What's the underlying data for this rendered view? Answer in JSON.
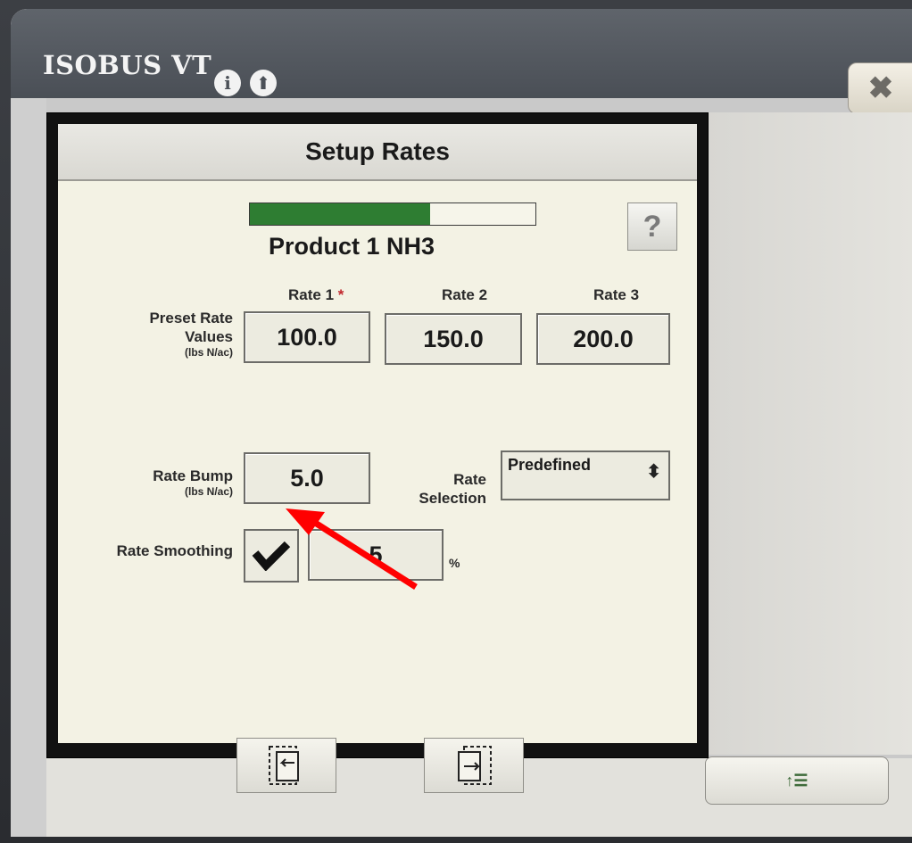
{
  "app": {
    "title": "ISOBUS VT",
    "info_icon": "i",
    "upload_icon": "⬆",
    "close_icon": "✖"
  },
  "dialog": {
    "title": "Setup Rates",
    "progress_fraction": 0.63,
    "help_label": "?",
    "product": "Product 1 NH3",
    "rates": {
      "headers": [
        "Rate 1",
        "Rate 2",
        "Rate 3"
      ],
      "required_marker": "*",
      "preset_label_line1": "Preset Rate",
      "preset_label_line2": "Values",
      "preset_unit": "(lbs N/ac)",
      "values": [
        "100.0",
        "150.0",
        "200.0"
      ]
    },
    "rate_bump": {
      "label": "Rate Bump",
      "unit": "(lbs N/ac)",
      "value": "5.0"
    },
    "rate_selection": {
      "label_line1": "Rate",
      "label_line2": "Selection",
      "value": "Predefined"
    },
    "rate_smoothing": {
      "label": "Rate Smoothing",
      "checked": true,
      "value": "5",
      "unit": "%"
    }
  },
  "footer": {
    "button_label": "↑☰"
  },
  "colors": {
    "progress": "#2e7d32",
    "annotation_arrow": "#ff0000"
  }
}
